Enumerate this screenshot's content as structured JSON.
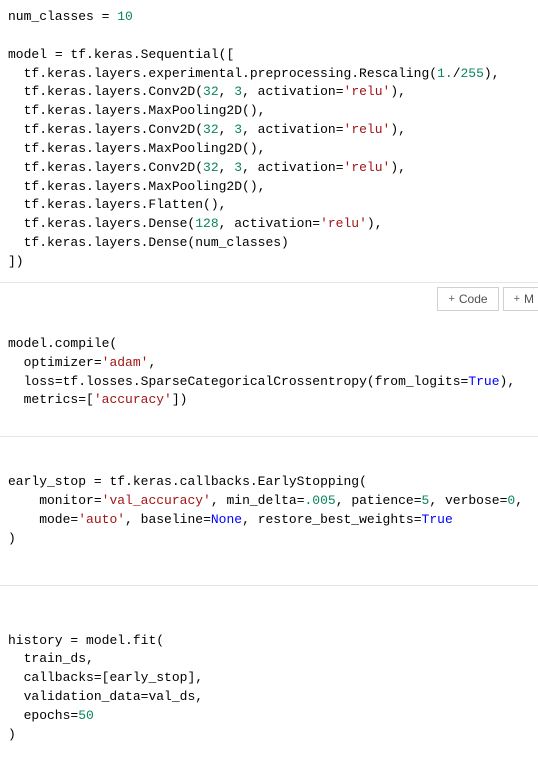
{
  "toolbar": {
    "code_label": "Code",
    "markdown_label": "M"
  },
  "cells": [
    {
      "tokens": [
        {
          "t": "num_classes ",
          "c": "nm"
        },
        {
          "t": "=",
          "c": "op"
        },
        {
          "t": " ",
          "c": "nm"
        },
        {
          "t": "10",
          "c": "num"
        },
        {
          "t": "\n\n",
          "c": "nm"
        },
        {
          "t": "model ",
          "c": "nm"
        },
        {
          "t": "=",
          "c": "op"
        },
        {
          "t": " tf.keras.Sequential([\n",
          "c": "nm"
        },
        {
          "t": "  tf.keras.layers.experimental.preprocessing.Rescaling(",
          "c": "nm"
        },
        {
          "t": "1.",
          "c": "num"
        },
        {
          "t": "/",
          "c": "op"
        },
        {
          "t": "255",
          "c": "num"
        },
        {
          "t": "),\n",
          "c": "nm"
        },
        {
          "t": "  tf.keras.layers.Conv2D(",
          "c": "nm"
        },
        {
          "t": "32",
          "c": "num"
        },
        {
          "t": ", ",
          "c": "nm"
        },
        {
          "t": "3",
          "c": "num"
        },
        {
          "t": ", activation",
          "c": "nm"
        },
        {
          "t": "=",
          "c": "op"
        },
        {
          "t": "'relu'",
          "c": "str"
        },
        {
          "t": "),\n",
          "c": "nm"
        },
        {
          "t": "  tf.keras.layers.MaxPooling2D(),\n",
          "c": "nm"
        },
        {
          "t": "  tf.keras.layers.Conv2D(",
          "c": "nm"
        },
        {
          "t": "32",
          "c": "num"
        },
        {
          "t": ", ",
          "c": "nm"
        },
        {
          "t": "3",
          "c": "num"
        },
        {
          "t": ", activation",
          "c": "nm"
        },
        {
          "t": "=",
          "c": "op"
        },
        {
          "t": "'relu'",
          "c": "str"
        },
        {
          "t": "),\n",
          "c": "nm"
        },
        {
          "t": "  tf.keras.layers.MaxPooling2D(),\n",
          "c": "nm"
        },
        {
          "t": "  tf.keras.layers.Conv2D(",
          "c": "nm"
        },
        {
          "t": "32",
          "c": "num"
        },
        {
          "t": ", ",
          "c": "nm"
        },
        {
          "t": "3",
          "c": "num"
        },
        {
          "t": ", activation",
          "c": "nm"
        },
        {
          "t": "=",
          "c": "op"
        },
        {
          "t": "'relu'",
          "c": "str"
        },
        {
          "t": "),\n",
          "c": "nm"
        },
        {
          "t": "  tf.keras.layers.MaxPooling2D(),\n",
          "c": "nm"
        },
        {
          "t": "  tf.keras.layers.Flatten(),\n",
          "c": "nm"
        },
        {
          "t": "  tf.keras.layers.Dense(",
          "c": "nm"
        },
        {
          "t": "128",
          "c": "num"
        },
        {
          "t": ", activation",
          "c": "nm"
        },
        {
          "t": "=",
          "c": "op"
        },
        {
          "t": "'relu'",
          "c": "str"
        },
        {
          "t": "),\n",
          "c": "nm"
        },
        {
          "t": "  tf.keras.layers.Dense(num_classes)\n",
          "c": "nm"
        },
        {
          "t": "])",
          "c": "nm"
        }
      ]
    },
    {
      "tokens": [
        {
          "t": "model.compile(\n",
          "c": "nm"
        },
        {
          "t": "  optimizer",
          "c": "nm"
        },
        {
          "t": "=",
          "c": "op"
        },
        {
          "t": "'adam'",
          "c": "str"
        },
        {
          "t": ",\n",
          "c": "nm"
        },
        {
          "t": "  loss",
          "c": "nm"
        },
        {
          "t": "=",
          "c": "op"
        },
        {
          "t": "tf.losses.SparseCategoricalCrossentropy(from_logits",
          "c": "nm"
        },
        {
          "t": "=",
          "c": "op"
        },
        {
          "t": "True",
          "c": "bool"
        },
        {
          "t": "),\n",
          "c": "nm"
        },
        {
          "t": "  metrics",
          "c": "nm"
        },
        {
          "t": "=",
          "c": "op"
        },
        {
          "t": "[",
          "c": "nm"
        },
        {
          "t": "'accuracy'",
          "c": "str"
        },
        {
          "t": "])",
          "c": "nm"
        }
      ]
    },
    {
      "tokens": [
        {
          "t": "early_stop ",
          "c": "nm"
        },
        {
          "t": "=",
          "c": "op"
        },
        {
          "t": " tf.keras.callbacks.EarlyStopping(\n",
          "c": "nm"
        },
        {
          "t": "    monitor",
          "c": "nm"
        },
        {
          "t": "=",
          "c": "op"
        },
        {
          "t": "'val_accuracy'",
          "c": "str"
        },
        {
          "t": ", min_delta",
          "c": "nm"
        },
        {
          "t": "=",
          "c": "op"
        },
        {
          "t": ".005",
          "c": "num"
        },
        {
          "t": ", patience",
          "c": "nm"
        },
        {
          "t": "=",
          "c": "op"
        },
        {
          "t": "5",
          "c": "num"
        },
        {
          "t": ", verbose",
          "c": "nm"
        },
        {
          "t": "=",
          "c": "op"
        },
        {
          "t": "0",
          "c": "num"
        },
        {
          "t": ",\n",
          "c": "nm"
        },
        {
          "t": "    mode",
          "c": "nm"
        },
        {
          "t": "=",
          "c": "op"
        },
        {
          "t": "'auto'",
          "c": "str"
        },
        {
          "t": ", baseline",
          "c": "nm"
        },
        {
          "t": "=",
          "c": "op"
        },
        {
          "t": "None",
          "c": "bool"
        },
        {
          "t": ", restore_best_weights",
          "c": "nm"
        },
        {
          "t": "=",
          "c": "op"
        },
        {
          "t": "True",
          "c": "bool"
        },
        {
          "t": "\n",
          "c": "nm"
        },
        {
          "t": ")",
          "c": "nm"
        }
      ]
    },
    {
      "tokens": [
        {
          "t": "history ",
          "c": "nm"
        },
        {
          "t": "=",
          "c": "op"
        },
        {
          "t": " model.fit(\n",
          "c": "nm"
        },
        {
          "t": "  train_ds,\n",
          "c": "nm"
        },
        {
          "t": "  callbacks",
          "c": "nm"
        },
        {
          "t": "=",
          "c": "op"
        },
        {
          "t": "[early_stop],\n",
          "c": "nm"
        },
        {
          "t": "  validation_data",
          "c": "nm"
        },
        {
          "t": "=",
          "c": "op"
        },
        {
          "t": "val_ds,\n",
          "c": "nm"
        },
        {
          "t": "  epochs",
          "c": "nm"
        },
        {
          "t": "=",
          "c": "op"
        },
        {
          "t": "50",
          "c": "num"
        },
        {
          "t": "\n",
          "c": "nm"
        },
        {
          "t": ")",
          "c": "nm"
        }
      ]
    }
  ]
}
